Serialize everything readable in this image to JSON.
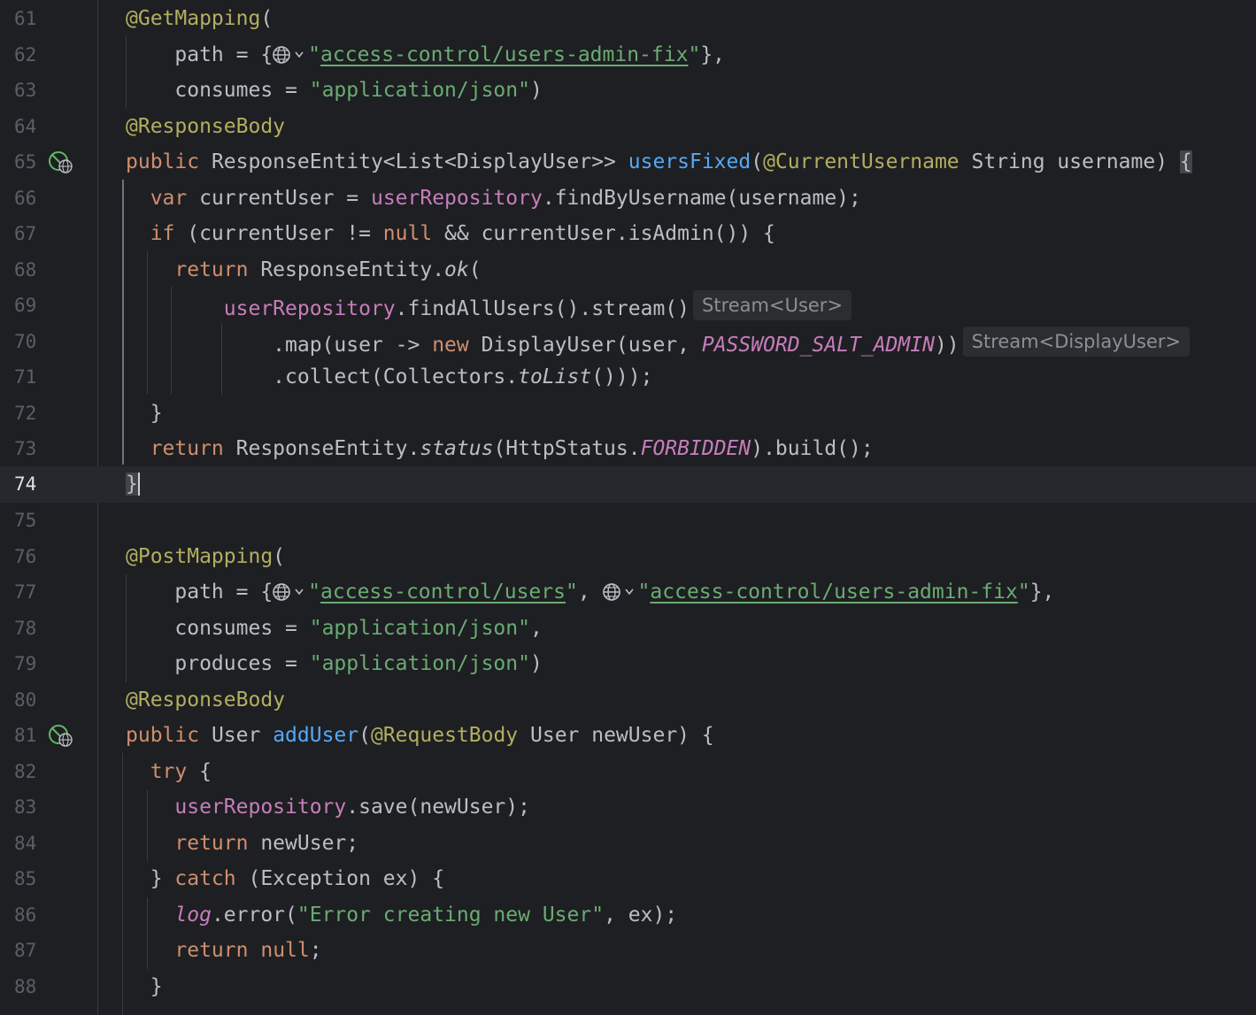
{
  "editor": {
    "current_line": "74",
    "hints": {
      "stream_user": "Stream<User>",
      "stream_display_user": "Stream<DisplayUser>"
    },
    "lines": [
      {
        "n": "61"
      },
      {
        "n": "62"
      },
      {
        "n": "63"
      },
      {
        "n": "64"
      },
      {
        "n": "65"
      },
      {
        "n": "66"
      },
      {
        "n": "67"
      },
      {
        "n": "68"
      },
      {
        "n": "69"
      },
      {
        "n": "70"
      },
      {
        "n": "71"
      },
      {
        "n": "72"
      },
      {
        "n": "73"
      },
      {
        "n": "74"
      },
      {
        "n": "75"
      },
      {
        "n": "76"
      },
      {
        "n": "77"
      },
      {
        "n": "78"
      },
      {
        "n": "79"
      },
      {
        "n": "80"
      },
      {
        "n": "81"
      },
      {
        "n": "82"
      },
      {
        "n": "83"
      },
      {
        "n": "84"
      },
      {
        "n": "85"
      },
      {
        "n": "86"
      },
      {
        "n": "87"
      },
      {
        "n": "88"
      }
    ],
    "code": {
      "l61": {
        "ann": "@GetMapping",
        "rest": "("
      },
      "l62": {
        "pre": "    path = {",
        "url": "access-control/users-admin-fix",
        "post": "},"
      },
      "l63": {
        "pre": "    consumes = ",
        "str": "\"application/json\"",
        "post": ")"
      },
      "l64": {
        "ann": "@ResponseBody"
      },
      "l65": {
        "kw": "public",
        "type": " ResponseEntity<List<DisplayUser>> ",
        "fn": "usersFixed",
        "p1": "(",
        "ann": "@CurrentUsername",
        "p2": " String username) ",
        "brace": "{"
      },
      "l66": {
        "kw": "  var",
        "mid": " currentUser = ",
        "fld": "userRepository",
        "post": ".findByUsername(username);"
      },
      "l67": {
        "kw": "  if",
        "mid": " (currentUser != ",
        "kw2": "null",
        "post": " && currentUser.isAdmin()) {"
      },
      "l68": {
        "kw": "    return",
        "mid": " ResponseEntity.",
        "it": "ok",
        "post": "("
      },
      "l69": {
        "pre": "        ",
        "fld": "userRepository",
        "post": ".findAllUsers().stream()"
      },
      "l70": {
        "pre": "            .map(user -> ",
        "kw": "new",
        "mid": " DisplayUser(user, ",
        "cst": "PASSWORD_SALT_ADMIN",
        "post": "))"
      },
      "l71": {
        "pre": "            .collect(Collectors.",
        "it": "toList",
        "post": "()));"
      },
      "l72": {
        "pre": "  }"
      },
      "l73": {
        "kw": "  return",
        "mid": " ResponseEntity.",
        "it": "status",
        "p2": "(HttpStatus.",
        "cst": "FORBIDDEN",
        "post": ").build();"
      },
      "l74": {
        "brace": "}"
      },
      "l75": {
        "pre": ""
      },
      "l76": {
        "ann": "@PostMapping",
        "rest": "("
      },
      "l77": {
        "pre": "    path = {",
        "url1": "access-control/users",
        "mid": ", ",
        "url2": "access-control/users-admin-fix",
        "post": "},"
      },
      "l78": {
        "pre": "    consumes = ",
        "str": "\"application/json\"",
        "post": ","
      },
      "l79": {
        "pre": "    produces = ",
        "str": "\"application/json\"",
        "post": ")"
      },
      "l80": {
        "ann": "@ResponseBody"
      },
      "l81": {
        "kw": "public",
        "type": " User ",
        "fn": "addUser",
        "p1": "(",
        "ann": "@RequestBody",
        "p2": " User newUser) {"
      },
      "l82": {
        "kw": "  try",
        "post": " {"
      },
      "l83": {
        "pre": "    ",
        "fld": "userRepository",
        "post": ".save(newUser);"
      },
      "l84": {
        "kw": "    return",
        "post": " newUser;"
      },
      "l85": {
        "pre": "  } ",
        "kw": "catch",
        "post": " (Exception ex) {"
      },
      "l86": {
        "pre": "    ",
        "fldit": "log",
        "mid": ".error(",
        "str": "\"Error creating new User\"",
        "post": ", ex);"
      },
      "l87": {
        "kw": "    return",
        "sp": " ",
        "kw2": "null",
        "post": ";"
      },
      "l88": {
        "pre": "  }"
      }
    }
  }
}
